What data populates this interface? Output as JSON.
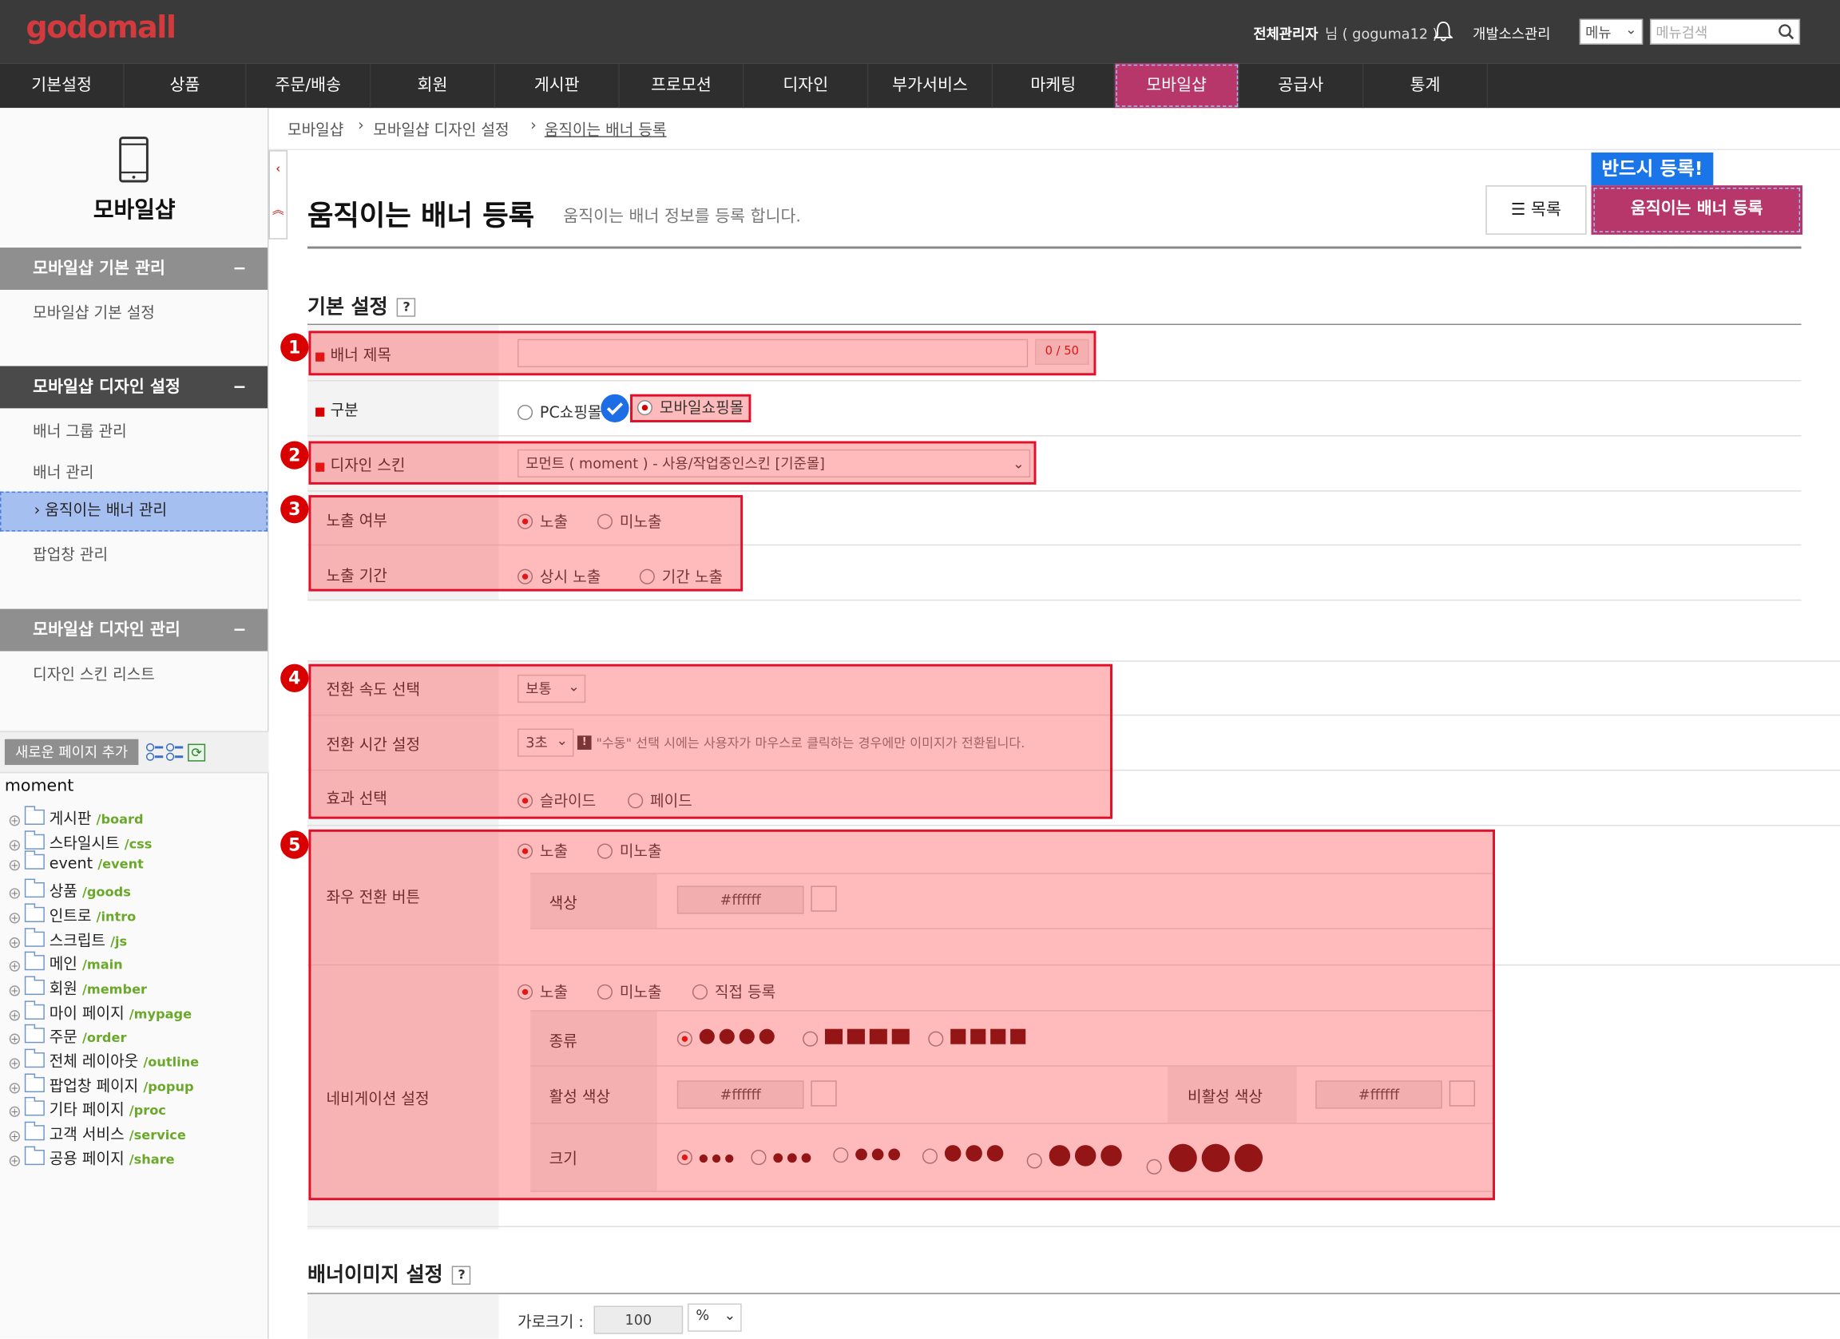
{
  "topbar": {
    "logo": "godomall",
    "admin_name": "전체관리자",
    "admin_suffix": "님 ( goguma12 )",
    "dev_source": "개발소스관리",
    "menu_select": "메뉴",
    "menu_search_placeholder": "메뉴검색"
  },
  "gnb": [
    "기본설정",
    "상품",
    "주문/배송",
    "회원",
    "게시판",
    "프로모션",
    "디자인",
    "부가서비스",
    "마케팅",
    "모바일샵",
    "공급사",
    "통계"
  ],
  "gnb_active": "모바일샵",
  "lnb": {
    "title": "모바일샵",
    "groups": [
      {
        "title": "모바일샵 기본 관리",
        "items": [
          "모바일샵 기본 설정"
        ]
      },
      {
        "title": "모바일샵 디자인 설정",
        "items": [
          "배너 그룹 관리",
          "배너 관리",
          "움직이는 배너 관리",
          "팝업창 관리"
        ]
      },
      {
        "title": "모바일샵 디자인 관리",
        "items": [
          "디자인 스킨 리스트"
        ]
      }
    ],
    "collapse_symbol": "−",
    "active_prefix": "›",
    "new_page_button": "새로운 페이지 추가",
    "tree_root": "moment",
    "tree": [
      {
        "name": "게시판",
        "path": "/board"
      },
      {
        "name": "스타일시트",
        "path": "/css"
      },
      {
        "name": "event",
        "path": "/event"
      },
      {
        "name": "상품",
        "path": "/goods"
      },
      {
        "name": "인트로",
        "path": "/intro"
      },
      {
        "name": "스크립트",
        "path": "/js"
      },
      {
        "name": "메인",
        "path": "/main"
      },
      {
        "name": "회원",
        "path": "/member"
      },
      {
        "name": "마이 페이지",
        "path": "/mypage"
      },
      {
        "name": "주문",
        "path": "/order"
      },
      {
        "name": "전체 레이아웃",
        "path": "/outline"
      },
      {
        "name": "팝업창 페이지",
        "path": "/popup"
      },
      {
        "name": "기타 페이지",
        "path": "/proc"
      },
      {
        "name": "고객 서비스",
        "path": "/service"
      },
      {
        "name": "공용 페이지",
        "path": "/share"
      }
    ]
  },
  "breadcrumb": [
    "모바일샵",
    "모바일샵 디자인 설정",
    "움직이는 배너 등록"
  ],
  "page": {
    "title": "움직이는 배너 등록",
    "subtitle": "움직이는 배너 정보를 등록 합니다.",
    "list_button": "목록",
    "register_button": "움직이는 배너 등록",
    "must_register_tag": "반드시 등록!"
  },
  "basic": {
    "section_title": "기본 설정",
    "help": "?",
    "banner_title_label": "배너 제목",
    "banner_title_value": "",
    "banner_title_count": "0 / 50",
    "category_label": "구분",
    "category_options": [
      "PC쇼핑몰",
      "모바일쇼핑몰"
    ],
    "skin_label": "디자인 스킨",
    "skin_value": "모먼트 ( moment ) - 사용/작업중인스킨 [기준몰]",
    "expose_label": "노출 여부",
    "expose_options": [
      "노출",
      "미노출"
    ],
    "period_label": "노출 기간",
    "period_options": [
      "상시 노출",
      "기간 노출"
    ],
    "speed_label": "전환 속도 선택",
    "speed_value": "보통",
    "time_label": "전환 시간 설정",
    "time_value": "3초",
    "time_note": "\"수동\" 선택 시에는 사용자가 마우스로 클릭하는 경우에만 이미지가 전환됩니다.",
    "effect_label": "효과 선택",
    "effect_options": [
      "슬라이드",
      "페이드"
    ],
    "arrow_label": "좌우 전환 버튼",
    "arrow_options": [
      "노출",
      "미노출"
    ],
    "color_label": "색상",
    "arrow_color": "#ffffff",
    "nav_label": "네비게이션 설정",
    "nav_options": [
      "노출",
      "미노출",
      "직접 등록"
    ],
    "nav_type_label": "종류",
    "active_color_label": "활성 색상",
    "active_color": "#ffffff",
    "inactive_color_label": "비활성 색상",
    "inactive_color": "#ffffff",
    "size_label": "크기",
    "badges": [
      "1",
      "2",
      "3",
      "4",
      "5"
    ]
  },
  "image_section": {
    "title": "배너이미지 설정",
    "help": "?",
    "width_label": "가로크기 :",
    "width_value": "100",
    "width_unit": "%"
  },
  "colors": {
    "accent": "#b8376a",
    "logo": "#d23a3e",
    "highlight": "#e0102a"
  }
}
